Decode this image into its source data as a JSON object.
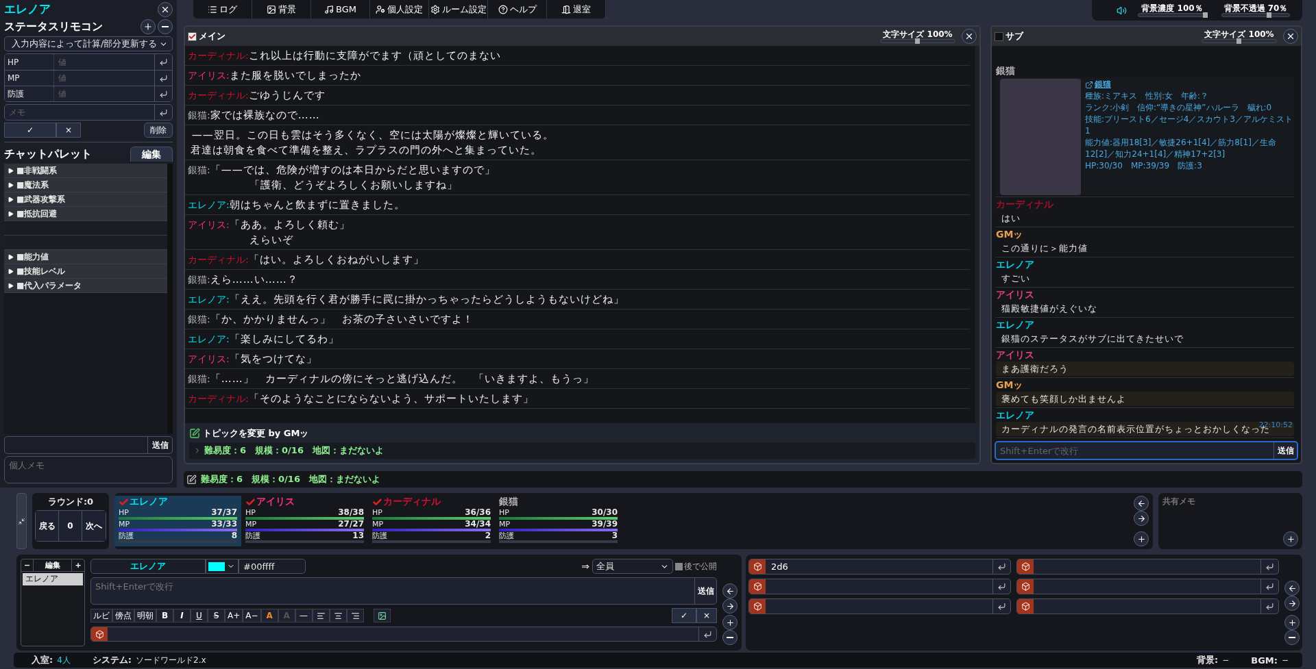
{
  "left_panel": {
    "character_name": "エレノア",
    "remote_title": "ステータスリモコン",
    "mode_select": "入力内容によって計算/部分更新する",
    "fields": [
      {
        "label": "HP",
        "placeholder": "値"
      },
      {
        "label": "MP",
        "placeholder": "値"
      },
      {
        "label": "防護",
        "placeholder": "値"
      }
    ],
    "memo_placeholder": "メモ",
    "ok_label": "✓",
    "cancel_label": "×",
    "delete_label": "削除",
    "palette_title": "チャットパレット",
    "edit_label": "編集",
    "palette_items": [
      {
        "kind": "group",
        "label": "■非戦闘系"
      },
      {
        "kind": "group",
        "label": "■魔法系"
      },
      {
        "kind": "group",
        "label": "■武器攻撃系"
      },
      {
        "kind": "group",
        "label": "■抵抗回避"
      },
      {
        "kind": "blank"
      },
      {
        "kind": "blank"
      },
      {
        "kind": "group",
        "label": "■能力値"
      },
      {
        "kind": "group",
        "label": "■技能レベル"
      },
      {
        "kind": "group",
        "label": "■代入パラメータ"
      }
    ],
    "send_label": "送信",
    "personal_memo_placeholder": "個人メモ"
  },
  "menu": [
    {
      "kind": "log",
      "label": "ログ"
    },
    {
      "kind": "background",
      "label": "背景"
    },
    {
      "kind": "bgm",
      "label": "BGM"
    },
    {
      "kind": "personal",
      "label": "個人設定"
    },
    {
      "kind": "room",
      "label": "ルーム設定"
    },
    {
      "kind": "help",
      "label": "ヘルプ"
    },
    {
      "kind": "exit",
      "label": "退室"
    }
  ],
  "display_sliders": [
    {
      "label": "背景濃度 100％",
      "level": 1.0
    },
    {
      "label": "背景不透過 70％",
      "level": 0.7
    }
  ],
  "main_tab": {
    "title": "メイン",
    "checked": true,
    "font_size": {
      "label": "文字サイズ 100%",
      "level": 0.5
    }
  },
  "main_messages": [
    {
      "speaker": "カーディナル:",
      "color": "#d0102c",
      "lines": [
        "これ以上は行動に支障がでます（頑としてのまない"
      ]
    },
    {
      "speaker": "アイリス:",
      "color": "#ff2d7d",
      "lines": [
        "また服を脱いでしまったか"
      ]
    },
    {
      "speaker": "カーディナル:",
      "color": "#d0102c",
      "lines": [
        "ごゆうじんです"
      ]
    },
    {
      "speaker": "銀猫:",
      "color": "#b4b4b4",
      "lines": [
        "家では裸族なので……"
      ]
    },
    {
      "lines": [
        "——翌日。この日も雲はそう多くなく、空には太陽が燦燦と輝いている。",
        "君達は朝食を食べて準備を整え、ラプラスの門の外へと集まっていた。"
      ]
    },
    {
      "speaker": "銀猫:",
      "color": "#b4b4b4",
      "lines": [
        "「——では、危険が増すのは本日からだと思いますので」",
        "「護衛、どうぞよろしくお願いしますね」"
      ]
    },
    {
      "speaker": "エレノア:",
      "color": "#00e1f0",
      "lines": [
        "朝はちゃんと飲まずに置きました。"
      ]
    },
    {
      "speaker": "アイリス:",
      "color": "#ff2d7d",
      "lines": [
        "「ああ。よろしく頼む」",
        "えらいぞ"
      ]
    },
    {
      "speaker": "カーディナル:",
      "color": "#d0102c",
      "lines": [
        "「はい。よろしくおねがいします」"
      ]
    },
    {
      "speaker": "銀猫:",
      "color": "#b4b4b4",
      "lines": [
        "えら……い……？"
      ]
    },
    {
      "speaker": "エレノア:",
      "color": "#00e1f0",
      "lines": [
        "「ええ。先頭を行く君が勝手に罠に掛かっちゃったらどうしようもないけどね」"
      ]
    },
    {
      "speaker": "銀猫:",
      "color": "#b4b4b4",
      "lines": [
        "「か、かかりませんっ」　お茶の子さいさいですよ！"
      ]
    },
    {
      "speaker": "エレノア:",
      "color": "#00e1f0",
      "lines": [
        "「楽しみにしてるわ」"
      ]
    },
    {
      "speaker": "アイリス:",
      "color": "#ff2d7d",
      "lines": [
        "「気をつけてな」"
      ]
    },
    {
      "speaker": "銀猫:",
      "color": "#b4b4b4",
      "lines": [
        "「……」　カーディナルの傍にそっと逃げ込んだ。　「いきますよ、もうっ」"
      ]
    },
    {
      "speaker": "カーディナル:",
      "color": "#d0102c",
      "lines": [
        "「そのようなことにならないよう、サポートいたします」"
      ]
    }
  ],
  "topic": {
    "title": "トピックを変更 by GMッ",
    "text": "難易度：6　規模：0/16　地図：まだないよ"
  },
  "sub_tab": {
    "title": "サブ",
    "checked": false,
    "font_size": {
      "label": "文字サイズ 100%",
      "level": 0.5
    }
  },
  "sub_messages": [
    {
      "kind": "card",
      "speaker": "銀猫",
      "link": "銀猫",
      "lines": [
        "種族:ミアキス　性別:女　年齢:？",
        "ランク:小剣　信仰:“導きの星神”ハルーラ　穢れ:0",
        "技能:プリースト6／セージ4／スカウト3／アルケミスト1",
        "能力値:器用18[3]／敏捷26+1[4]／筋力8[1]／生命12[2]／知力24+1[4]／精神17+2[3]",
        "HP:30/30　MP:39/39　防護:3"
      ]
    },
    {
      "kind": "message",
      "speaker": "カーディナル",
      "color": "#a0102a",
      "text": "はい",
      "highlighted": false
    },
    {
      "kind": "message",
      "speaker": "GMッ",
      "color": "#e8a050",
      "text": "この通りに＞能力値",
      "highlighted": false
    },
    {
      "kind": "message",
      "speaker": "エレノア",
      "color": "#00d4e8",
      "text": "すごい",
      "highlighted": false
    },
    {
      "kind": "message",
      "speaker": "アイリス",
      "color": "#e0407a",
      "text": "猫殿敏捷値がえぐいな",
      "highlighted": false
    },
    {
      "kind": "message",
      "speaker": "エレノア",
      "color": "#00d4e8",
      "text": "銀猫のステータスがサブに出てきたせいで",
      "highlighted": false
    },
    {
      "kind": "message",
      "speaker": "アイリス",
      "color": "#e0407a",
      "text": "まあ護衛だろう",
      "highlighted": true
    },
    {
      "kind": "message",
      "speaker": "GMッ",
      "color": "#e8a050",
      "text": "褒めても笑顔しか出ませんよ",
      "highlighted": true
    },
    {
      "kind": "message",
      "speaker": "エレノア",
      "color": "#00d4e8",
      "text": "カーディナルの発言の名前表示位置がちょっとおかしくなった",
      "highlighted": true,
      "time": "22:10:52"
    }
  ],
  "sub_input": {
    "placeholder": "Shift+Enterで改行",
    "send_label": "送信"
  },
  "topic_bar": {
    "text": "難易度：6　規模：0/16　地図：まだないよ"
  },
  "round": {
    "label": "ラウンド:0",
    "back_label": "戻る",
    "count": "0",
    "next_label": "次へ"
  },
  "party": [
    {
      "name": "エレノア",
      "color": "#00e1f0",
      "checked": true,
      "selected": true,
      "stats": [
        {
          "kind": "hp",
          "label": "HP",
          "value": "37/37",
          "level": 1.0
        },
        {
          "kind": "mp",
          "label": "MP",
          "value": "33/33",
          "level": 1.0
        },
        {
          "kind": "plain",
          "label": "防護",
          "value": "8"
        }
      ]
    },
    {
      "name": "アイリス",
      "color": "#ff2d7d",
      "checked": true,
      "selected": false,
      "stats": [
        {
          "kind": "hp",
          "label": "HP",
          "value": "38/38",
          "level": 1.0
        },
        {
          "kind": "mp",
          "label": "MP",
          "value": "27/27",
          "level": 1.0
        },
        {
          "kind": "plain",
          "label": "防護",
          "value": "13"
        }
      ]
    },
    {
      "name": "カーディナル",
      "color": "#d0102c",
      "checked": true,
      "selected": false,
      "stats": [
        {
          "kind": "hp",
          "label": "HP",
          "value": "36/36",
          "level": 1.0
        },
        {
          "kind": "mp",
          "label": "MP",
          "value": "34/34",
          "level": 1.0
        },
        {
          "kind": "plain",
          "label": "防護",
          "value": "2"
        }
      ]
    },
    {
      "name": "銀猫",
      "color": "#b4b4b4",
      "checked": false,
      "selected": false,
      "stats": [
        {
          "kind": "hp",
          "label": "HP",
          "value": "30/30",
          "level": 1.0
        },
        {
          "kind": "mp",
          "label": "MP",
          "value": "39/39",
          "level": 1.0
        },
        {
          "kind": "plain",
          "label": "防護",
          "value": "3"
        }
      ]
    }
  ],
  "shared_memo": {
    "placeholder": "共有メモ"
  },
  "input": {
    "minus_label": "−",
    "edit_label": "編集",
    "plus_label": "+",
    "characters": [
      {
        "name": "エレノア",
        "selected": true
      }
    ],
    "name": "エレノア",
    "color_value": "#00ffff",
    "color": "#00ffff",
    "arrow": "⇒",
    "target": "全員",
    "later_label": "後で公開",
    "later_checked": false,
    "placeholder": "Shift+Enterで改行",
    "send_label": "送信",
    "toolbar": [
      {
        "kind": "plain",
        "label": "ルビ"
      },
      {
        "kind": "plain",
        "label": "傍点"
      },
      {
        "kind": "plain",
        "label": "明朝"
      },
      {
        "kind": "bold",
        "label": "B"
      },
      {
        "kind": "italic",
        "label": "I"
      },
      {
        "kind": "underline",
        "label": "U"
      },
      {
        "kind": "strike",
        "label": "S"
      },
      {
        "kind": "plain",
        "label": "A+"
      },
      {
        "kind": "plain",
        "label": "A−"
      },
      {
        "kind": "orange",
        "label": "A"
      },
      {
        "kind": "disabled",
        "label": "A"
      },
      {
        "kind": "plain",
        "label": "—"
      },
      {
        "kind": "align-left"
      },
      {
        "kind": "align-center"
      },
      {
        "kind": "align-right"
      },
      {
        "kind": "image"
      }
    ],
    "ok_label": "✓",
    "cancel_label": "×"
  },
  "dice_columns": [
    {
      "rows": [
        {
          "value": "2d6"
        },
        {},
        {}
      ]
    },
    {
      "rows": [
        {},
        {},
        {}
      ]
    }
  ],
  "status_bar": {
    "room_label": "入室:",
    "room_value": "4人",
    "system_label": "システム:",
    "system_value": "ソードワールド2.x",
    "bg_label": "背景:",
    "bg_value": "−",
    "bgm_label": "BGM:",
    "bgm_value": "−"
  }
}
